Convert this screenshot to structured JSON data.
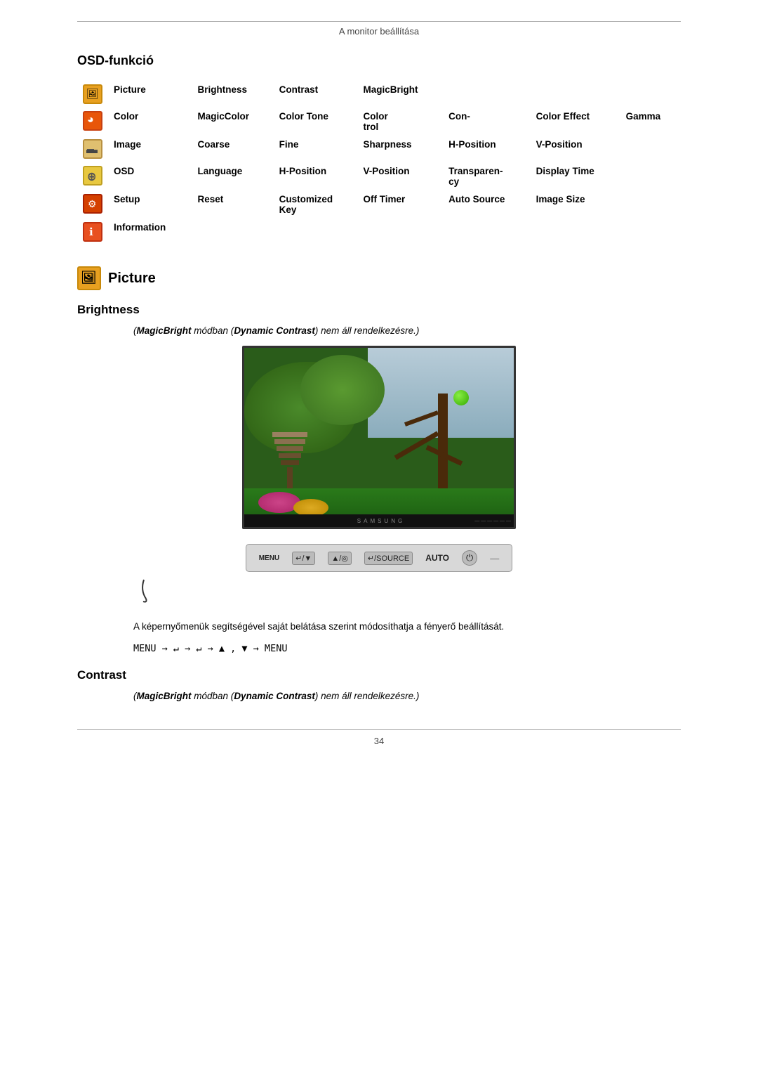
{
  "header": {
    "title": "A monitor beállítása"
  },
  "osd_section": {
    "title": "OSD-funkció",
    "rows": [
      {
        "icon": "picture",
        "menu": "Picture",
        "items": [
          "Brightness",
          "Contrast",
          "MagicBright"
        ]
      },
      {
        "icon": "color",
        "menu": "Color",
        "items": [
          "MagicColor",
          "Color Tone",
          "Color trol",
          "Con-",
          "Color Effect",
          "Gamma"
        ]
      },
      {
        "icon": "image",
        "menu": "Image",
        "items": [
          "Coarse",
          "Fine",
          "Sharpness",
          "H-Position",
          "V-Position"
        ]
      },
      {
        "icon": "osd",
        "menu": "OSD",
        "items": [
          "Language",
          "H-Position",
          "V-Position",
          "Transparen- cy",
          "Display Time"
        ]
      },
      {
        "icon": "setup",
        "menu": "Setup",
        "items": [
          "Reset",
          "Customized Key",
          "Off Timer",
          "Auto Source",
          "Image Size"
        ]
      },
      {
        "icon": "info",
        "menu": "Information",
        "items": []
      }
    ]
  },
  "picture_section": {
    "heading": "Picture",
    "brightness_title": "Brightness",
    "brightness_note": "(MagicBright módban (Dynamic Contrast) nem áll rendelkezésre.)",
    "samsung_label": "SAMSUNG",
    "controls": {
      "menu": "MENU",
      "btn1": "↵/▼",
      "btn2": "▲/◎",
      "btn3": "↵/SOURCE",
      "auto": "AUTO",
      "power": "⏻",
      "dash": "—"
    },
    "desc": "A képernyőmenük segítségével saját belátása szerint módosíthatja a fényerő beállítását.",
    "menu_path": "MENU → ↵ → ↵ → ▲ , ▼ → MENU",
    "contrast_title": "Contrast",
    "contrast_note": "(MagicBright módban (Dynamic Contrast) nem áll rendelkezésre.)"
  },
  "footer": {
    "page_number": "34"
  }
}
